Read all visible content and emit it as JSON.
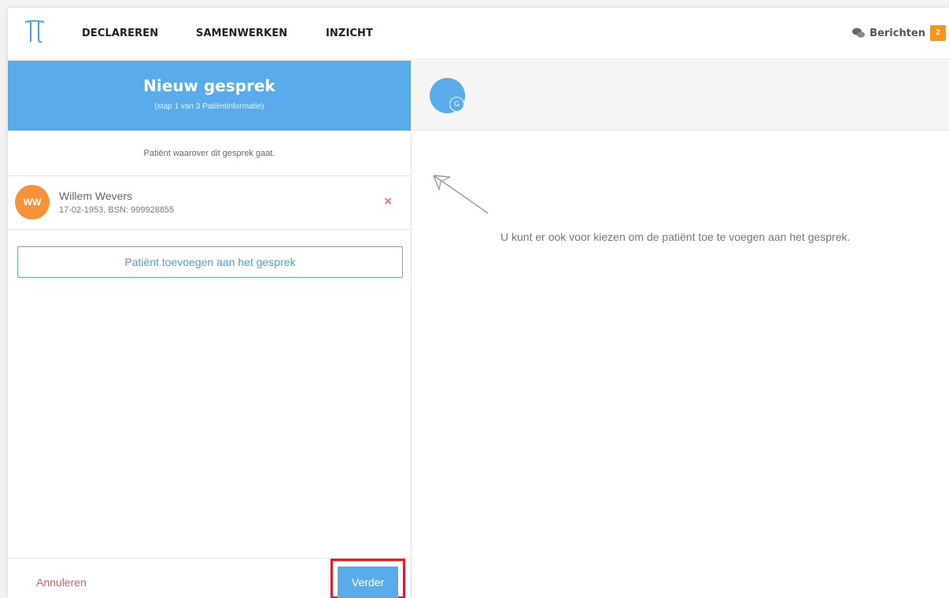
{
  "nav": {
    "items": [
      "DECLAREREN",
      "SAMENWERKEN",
      "INZICHT"
    ],
    "messages_label": "Berichten",
    "messages_count": "2",
    "logo_icon": "pi-logo-icon",
    "chat_icon": "chat-bubbles-icon"
  },
  "left_panel": {
    "title": "Nieuw gesprek",
    "subtitle": "(stap 1 van 3 Patiëntinformatie)",
    "hint": "Patiënt waarover dit gesprek gaat.",
    "patient": {
      "initials": "WW",
      "name": "Willem Wevers",
      "meta": "17-02-1953, BSN: 999928855",
      "remove_glyph": "×"
    },
    "add_button": "Patiënt toevoegen aan het gesprek",
    "cancel_label": "Annuleren",
    "next_label": "Verder"
  },
  "right_panel": {
    "group_badge": "G",
    "suggestion": "U kunt er ook voor kiezen om de patiënt toe te voegen aan het gesprek."
  },
  "colors": {
    "accent": "#5aabea",
    "badge": "#f7941d",
    "avatar": "#f7923a",
    "danger": "#e35d5d",
    "highlight": "#e31e24"
  }
}
